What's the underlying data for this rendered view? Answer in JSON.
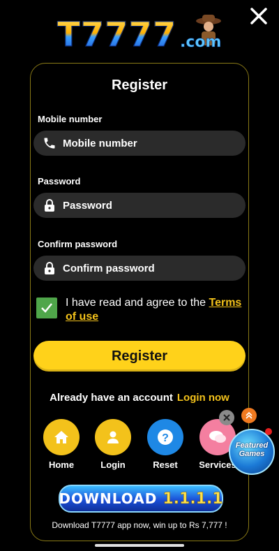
{
  "brand": {
    "logo_main": "T7777",
    "logo_suffix": ".com"
  },
  "form": {
    "title": "Register",
    "mobile": {
      "label": "Mobile number",
      "placeholder": "Mobile number"
    },
    "password": {
      "label": "Password",
      "placeholder": "Password"
    },
    "confirm": {
      "label": "Confirm password",
      "placeholder": "Confirm password"
    },
    "agree": {
      "checked": true,
      "text": "I have read and agree to the ",
      "terms_link": "Terms of use"
    },
    "submit_label": "Register",
    "login_prompt": "Already have an account",
    "login_link": "Login now"
  },
  "nav": [
    {
      "label": "Home",
      "icon": "home-icon",
      "color": "#f3c21b"
    },
    {
      "label": "Login",
      "icon": "user-icon",
      "color": "#f3c21b"
    },
    {
      "label": "Reset",
      "icon": "help-icon",
      "color": "#1e88e5"
    },
    {
      "label": "Services",
      "icon": "chat-icon",
      "color": "#f47fa0"
    }
  ],
  "featured": {
    "label": "Featured Games"
  },
  "download": {
    "label": "DOWNLOAD",
    "version": "1.1.1.1",
    "note": "Download T7777 app now, win up to Rs 7,777 !"
  },
  "colors": {
    "accent": "#f3c21b",
    "button": "#ffd21a",
    "field_bg": "#2b2b2b",
    "check": "#4fa64a"
  }
}
